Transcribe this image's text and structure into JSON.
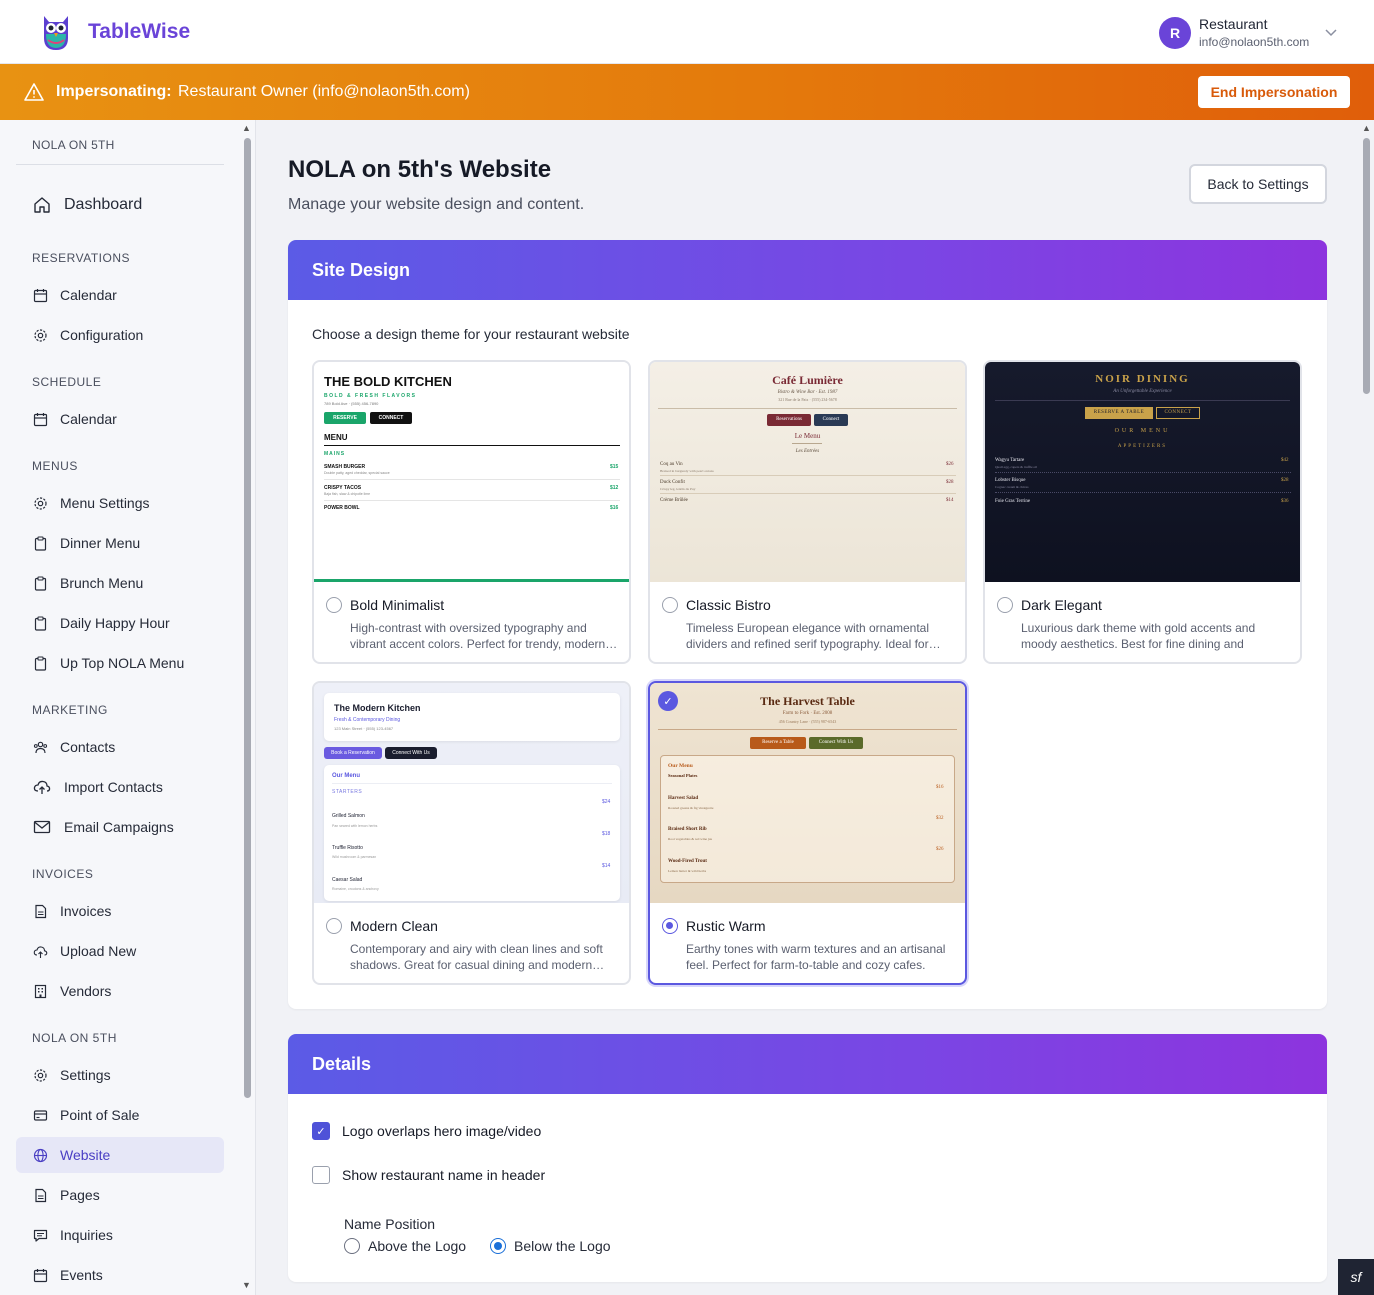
{
  "app": {
    "brand": "TableWise"
  },
  "user": {
    "initial": "R",
    "name": "Restaurant",
    "email": "info@nolaon5th.com"
  },
  "banner": {
    "label": "Impersonating:",
    "who": "Restaurant Owner (info@nolaon5th.com)",
    "end_button": "End Impersonation"
  },
  "sidebar": {
    "org": "NOLA ON 5TH",
    "dashboard": "Dashboard",
    "sections": {
      "reservations": "RESERVATIONS",
      "schedule": "SCHEDULE",
      "menus": "MENUS",
      "marketing": "MARKETING",
      "invoices": "INVOICES",
      "org": "NOLA ON 5TH"
    },
    "items": {
      "res_calendar": "Calendar",
      "res_config": "Configuration",
      "sched_calendar": "Calendar",
      "menu_settings": "Menu Settings",
      "dinner_menu": "Dinner Menu",
      "brunch_menu": "Brunch Menu",
      "happy_hour": "Daily Happy Hour",
      "up_top": "Up Top NOLA Menu",
      "contacts": "Contacts",
      "import_contacts": "Import Contacts",
      "email_campaigns": "Email Campaigns",
      "invoices": "Invoices",
      "upload_new": "Upload New",
      "vendors": "Vendors",
      "settings": "Settings",
      "pos": "Point of Sale",
      "website": "Website",
      "pages": "Pages",
      "inquiries": "Inquiries",
      "events": "Events"
    }
  },
  "page": {
    "title": "NOLA on 5th's Website",
    "subtitle": "Manage your website design and content.",
    "back_button": "Back to Settings"
  },
  "site_design": {
    "heading": "Site Design",
    "choose": "Choose a design theme for your restaurant website",
    "themes": [
      {
        "name": "Bold Minimalist",
        "desc": "High-contrast with oversized typography and vibrant accent colors. Perfect for trendy, modern…",
        "selected": false,
        "preview": {
          "title": "THE BOLD KITCHEN",
          "tag": "BOLD & FRESH FLAVORS",
          "addr": "789 Bold Ave · (555) 456-7890",
          "btn1": "RESERVE",
          "btn2": "CONNECT",
          "menu": "MENU",
          "section": "MAINS",
          "items": [
            {
              "n": "SMASH BURGER",
              "d": "Double patty, aged cheddar, special sauce",
              "p": "$15"
            },
            {
              "n": "CRISPY TACOS",
              "d": "Baja fish, slaw & chipotle lime",
              "p": "$12"
            },
            {
              "n": "POWER BOWL",
              "d": "",
              "p": "$16"
            }
          ]
        }
      },
      {
        "name": "Classic Bistro",
        "desc": "Timeless European elegance with ornamental dividers and refined serif typography. Ideal for…",
        "selected": false,
        "preview": {
          "title": "Café Lumière",
          "tag": "Bistro & Wine Bar · Est. 1987",
          "addr": "321 Rue de la Paix · (555) 234-5678",
          "btn1": "Reservations",
          "btn2": "Connect",
          "menu": "Le Menu",
          "section": "Les Entrées",
          "items": [
            {
              "n": "Coq au Vin",
              "d": "Braised in burgundy with pearl onions",
              "p": "$26"
            },
            {
              "n": "Duck Confit",
              "d": "Crispy leg, lentils du Puy",
              "p": "$28"
            },
            {
              "n": "Crème Brûlée",
              "d": "",
              "p": "$14"
            }
          ]
        }
      },
      {
        "name": "Dark Elegant",
        "desc": "Luxurious dark theme with gold accents and moody aesthetics. Best for fine dining and upsca…",
        "selected": false,
        "preview": {
          "title": "NOIR DINING",
          "tag": "An Unforgettable Experience",
          "btn1": "RESERVE A TABLE",
          "btn2": "CONNECT",
          "menu": "OUR MENU",
          "section": "APPETIZERS",
          "items": [
            {
              "n": "Wagyu Tartare",
              "d": "Quail egg, capers & truffle oil",
              "p": "$42"
            },
            {
              "n": "Lobster Bisque",
              "d": "Cognac cream & chives",
              "p": "$28"
            },
            {
              "n": "Foie Gras Terrine",
              "d": "",
              "p": "$36"
            }
          ]
        }
      },
      {
        "name": "Modern Clean",
        "desc": "Contemporary and airy with clean lines and soft shadows. Great for casual dining and modern…",
        "selected": false,
        "preview": {
          "title": "The Modern Kitchen",
          "tag": "Fresh & Contemporary Dining",
          "addr": "123 Main Street · (555) 123-4567",
          "btn1": "Book a Reservation",
          "btn2": "Connect With Us",
          "menu": "Our Menu",
          "section": "STARTERS",
          "items": [
            {
              "n": "Grilled Salmon",
              "d": "Pan seared with lemon herbs",
              "p": "$24"
            },
            {
              "n": "Truffle Risotto",
              "d": "Wild mushroom & parmesan",
              "p": "$18"
            },
            {
              "n": "Caesar Salad",
              "d": "Romaine, croutons & anchovy",
              "p": "$14"
            }
          ]
        }
      },
      {
        "name": "Rustic Warm",
        "desc": "Earthy tones with warm textures and an artisanal feel. Perfect for farm-to-table and cozy cafes.",
        "selected": true,
        "preview": {
          "title": "The Harvest Table",
          "tag": "Farm to Fork · Est. 2008",
          "addr": "456 Country Lane · (555) 987-6543",
          "btn1": "Reserve a Table",
          "btn2": "Connect With Us",
          "menu": "Our Menu",
          "section": "Seasonal Plates",
          "items": [
            {
              "n": "Harvest Salad",
              "d": "Roasted greens & fig vinaigrette",
              "p": "$16"
            },
            {
              "n": "Braised Short Rib",
              "d": "Root vegetables & red wine jus",
              "p": "$32"
            },
            {
              "n": "Wood-Fired Trout",
              "d": "Lemon butter & wild herbs",
              "p": "$26"
            }
          ]
        }
      }
    ]
  },
  "details": {
    "heading": "Details",
    "logo_overlaps": {
      "label": "Logo overlaps hero image/video",
      "checked": true
    },
    "show_name": {
      "label": "Show restaurant name in header",
      "checked": false
    },
    "name_position": {
      "label": "Name Position",
      "above": "Above the Logo",
      "below": "Below the Logo",
      "selected": "below"
    }
  },
  "colors": {
    "accent": "#5b58e0",
    "brand": "#6a44d8",
    "banner": "#e47a0c"
  }
}
